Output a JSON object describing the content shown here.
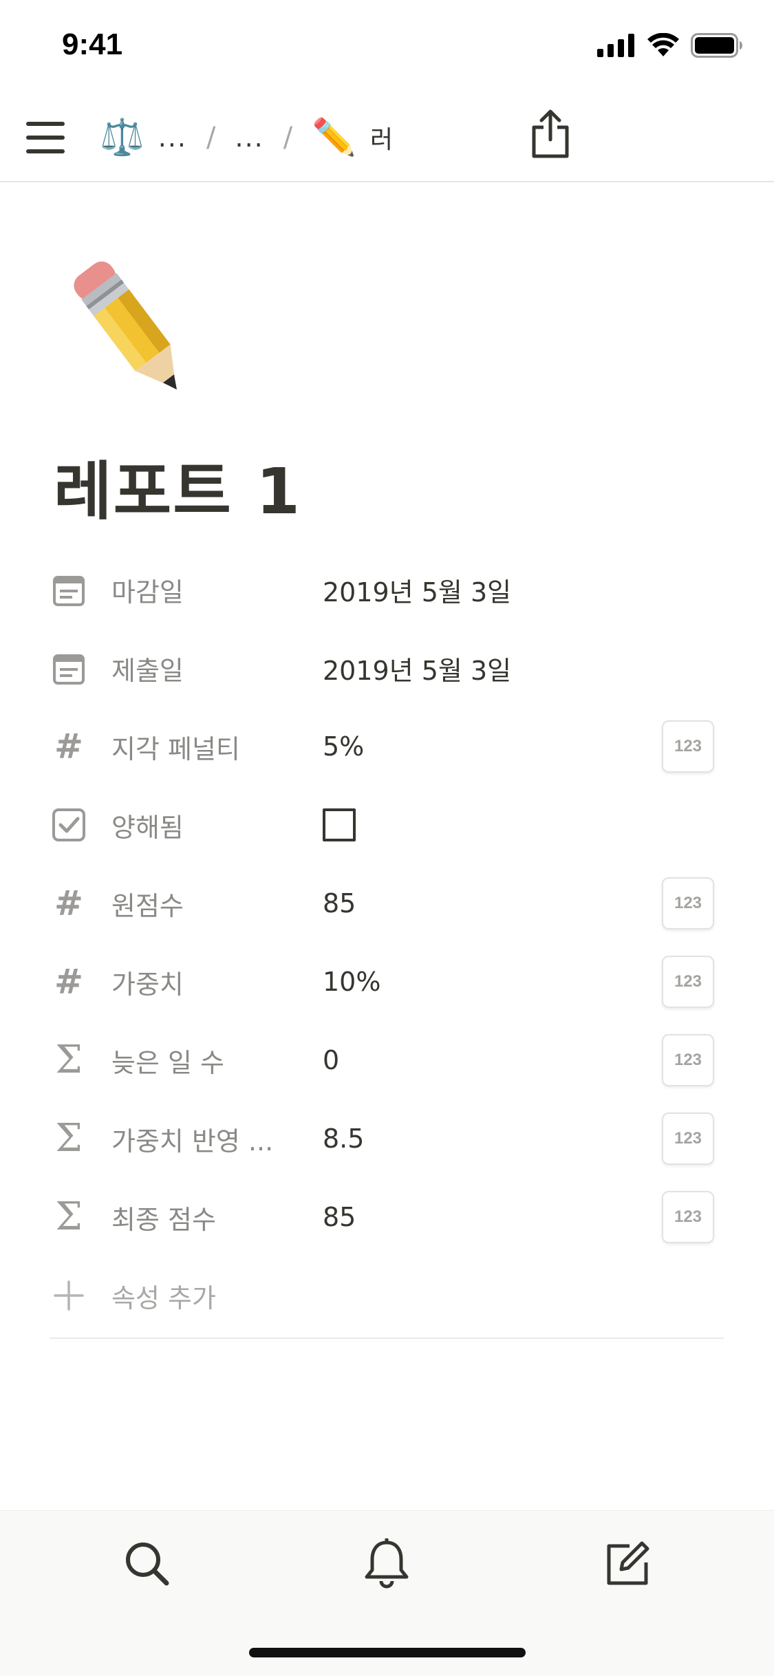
{
  "status_bar": {
    "time": "9:41"
  },
  "nav": {
    "crumbs": [
      {
        "emoji": "⚖️",
        "label": "..."
      },
      {
        "emoji": "",
        "label": "..."
      },
      {
        "emoji": "✏️",
        "label": "러"
      }
    ],
    "separator": "/"
  },
  "page": {
    "icon": "pencil-emoji",
    "title": "레포트 1"
  },
  "properties": [
    {
      "icon": "calendar-icon",
      "name": "마감일",
      "value": "2019년 5월 3일",
      "type_badge": ""
    },
    {
      "icon": "calendar-icon",
      "name": "제출일",
      "value": "2019년 5월 3일",
      "type_badge": ""
    },
    {
      "icon": "hash-icon",
      "name": "지각 페널티",
      "value": "5%",
      "type_badge": "123"
    },
    {
      "icon": "checkbox-icon",
      "name": "양해됨",
      "value": "",
      "checked": false,
      "type_badge": ""
    },
    {
      "icon": "hash-icon",
      "name": "원점수",
      "value": "85",
      "type_badge": "123"
    },
    {
      "icon": "hash-icon",
      "name": "가중치",
      "value": "10%",
      "type_badge": "123"
    },
    {
      "icon": "sigma-icon",
      "name": "늦은 일 수",
      "value": "0",
      "type_badge": "123"
    },
    {
      "icon": "sigma-icon",
      "name": "가중치 반영 ...",
      "value": "8.5",
      "type_badge": "123"
    },
    {
      "icon": "sigma-icon",
      "name": "최종 점수",
      "value": "85",
      "type_badge": "123"
    }
  ],
  "add_property": {
    "icon": "plus-icon",
    "label": "속성 추가"
  },
  "bottom_bar": {
    "items": [
      "search-icon",
      "bell-icon",
      "compose-icon"
    ]
  },
  "colors": {
    "text": "#37352f",
    "muted": "#9b9a97",
    "divider": "#e9e9e7"
  }
}
